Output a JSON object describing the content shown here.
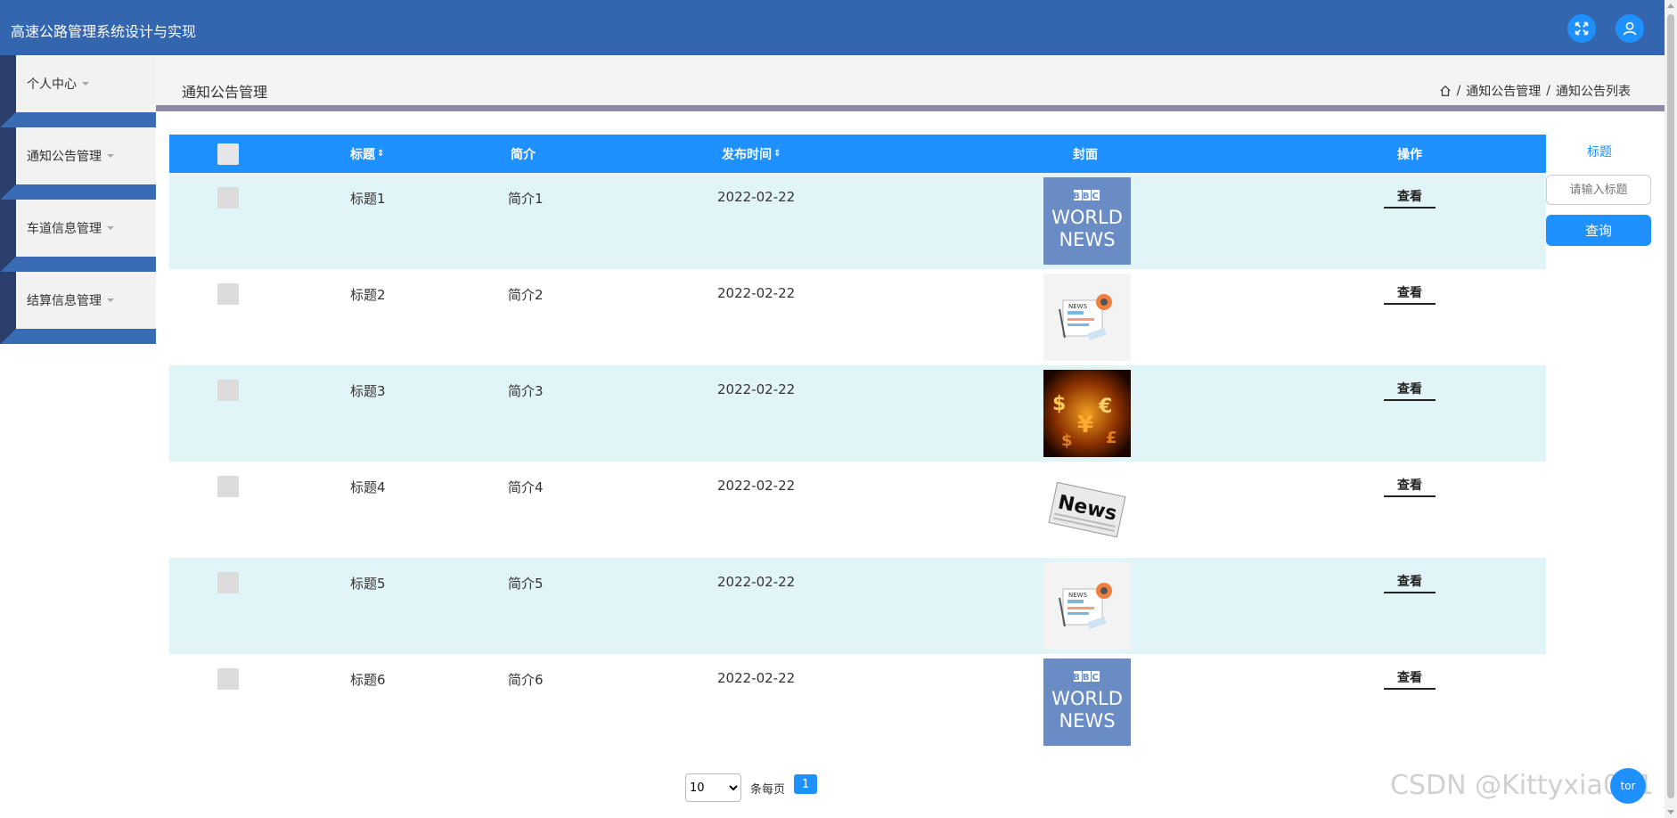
{
  "header": {
    "app_title": "高速公路管理系统设计与实现",
    "expand_icon": "fullscreen-icon",
    "user_icon": "user-icon"
  },
  "sidebar": {
    "items": [
      {
        "label": "个人中心"
      },
      {
        "label": "通知公告管理"
      },
      {
        "label": "车道信息管理"
      },
      {
        "label": "结算信息管理"
      }
    ]
  },
  "page": {
    "title": "通知公告管理",
    "breadcrumb": [
      "通知公告管理",
      "通知公告列表"
    ],
    "breadcrumb_sep": "/"
  },
  "table": {
    "columns": [
      "标题",
      "简介",
      "发布时间",
      "封面",
      "操作"
    ],
    "sort_glyph": "⇕",
    "rows": [
      {
        "title": "标题1",
        "intro": "简介1",
        "date": "2022-02-22",
        "cover": "bbc",
        "action": "查看"
      },
      {
        "title": "标题2",
        "intro": "简介2",
        "date": "2022-02-22",
        "cover": "newsdoc",
        "action": "查看"
      },
      {
        "title": "标题3",
        "intro": "简介3",
        "date": "2022-02-22",
        "cover": "money",
        "action": "查看"
      },
      {
        "title": "标题4",
        "intro": "简介4",
        "date": "2022-02-22",
        "cover": "newspaper",
        "action": "查看"
      },
      {
        "title": "标题5",
        "intro": "简介5",
        "date": "2022-02-22",
        "cover": "newsdoc",
        "action": "查看"
      },
      {
        "title": "标题6",
        "intro": "简介6",
        "date": "2022-02-22",
        "cover": "bbc",
        "action": "查看"
      }
    ]
  },
  "search": {
    "label": "标题",
    "placeholder": "请输入标题",
    "button": "查询"
  },
  "pagination": {
    "page_size": "10",
    "per_page_label": "条每页",
    "current_page": "1"
  },
  "bbc_text": {
    "line1": "BBC",
    "line2": "WORLD",
    "line3": "NEWS"
  },
  "news_text": "News",
  "watermark": "CSDN @Kittyxia001",
  "float_button": "tor"
}
